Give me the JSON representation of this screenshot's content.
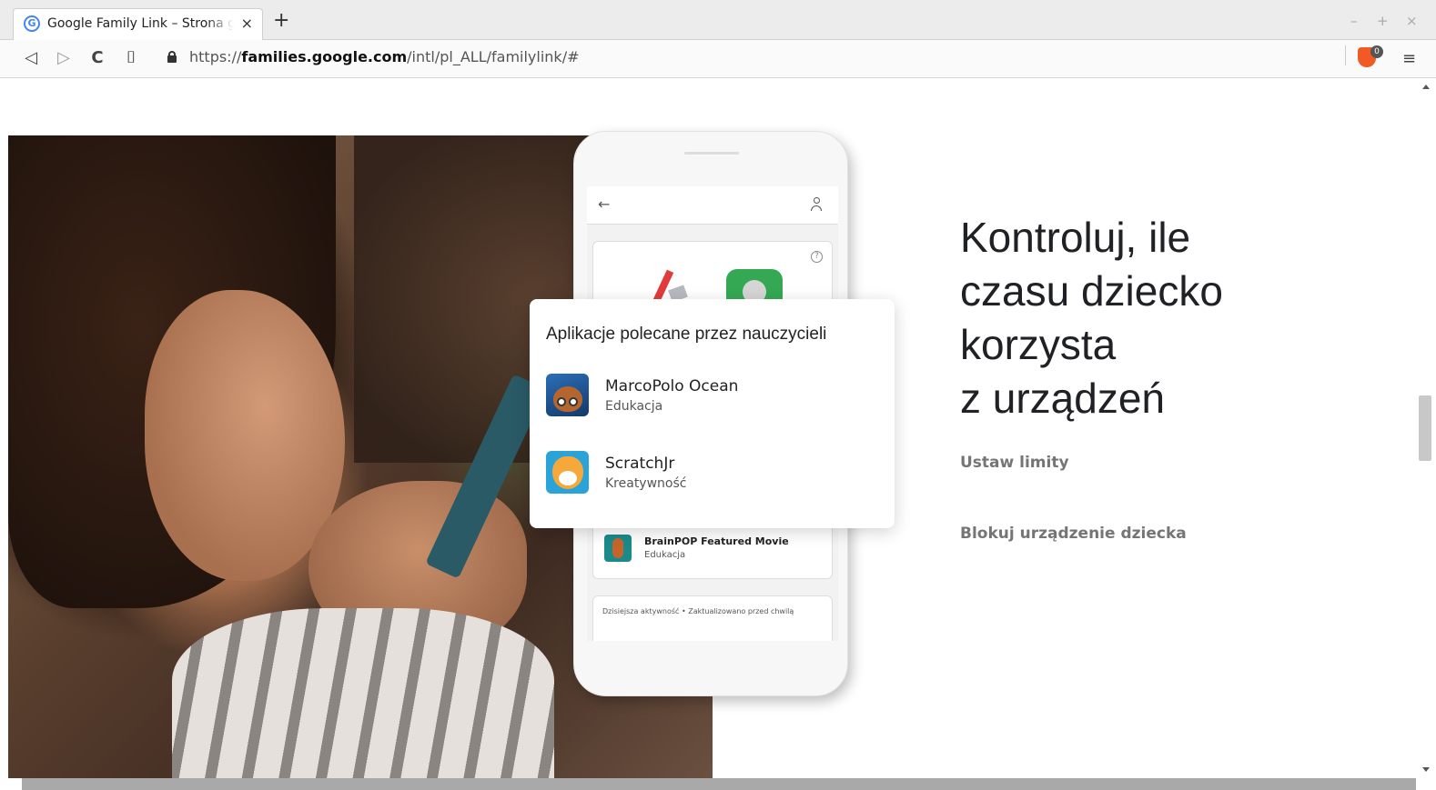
{
  "browser": {
    "tab_title": "Google Family Link – Strona główna",
    "tab_favicon_letter": "G",
    "tab_close": "×",
    "new_tab": "+",
    "window_minimize": "–",
    "window_maximize": "+",
    "window_close": "×",
    "url_prefix": "https://",
    "url_domain": "families.google.com",
    "url_path": "/intl/pl_ALL/familylink/#",
    "brave_badge": "0",
    "menu_glyph": "≡",
    "back_glyph": "◁",
    "forward_glyph": "▷",
    "reload_glyph": "C",
    "bookmark_glyph": "⌷"
  },
  "phone": {
    "back_glyph": "←",
    "help_glyph": "?",
    "rows": [
      {
        "title": "BrainPOP Featured Movie",
        "category": "Edukacja"
      }
    ],
    "activity_text": "Dzisiejsza aktywność • Zaktualizowano przed chwilą"
  },
  "card": {
    "title": "Aplikacje polecane przez nauczycieli",
    "apps": [
      {
        "name": "MarcoPolo Ocean",
        "category": "Edukacja"
      },
      {
        "name": "ScratchJr",
        "category": "Kreatywność"
      }
    ]
  },
  "hero": {
    "headline_lines": [
      "Kontroluj, ile",
      "czasu dziecko",
      "korzysta",
      "z urządzeń"
    ],
    "links": [
      "Ustaw limity",
      "Blokuj urządzenie dziecka"
    ]
  },
  "colors": {
    "headline": "#202124",
    "link": "#757575",
    "brave": "#f15a24"
  }
}
